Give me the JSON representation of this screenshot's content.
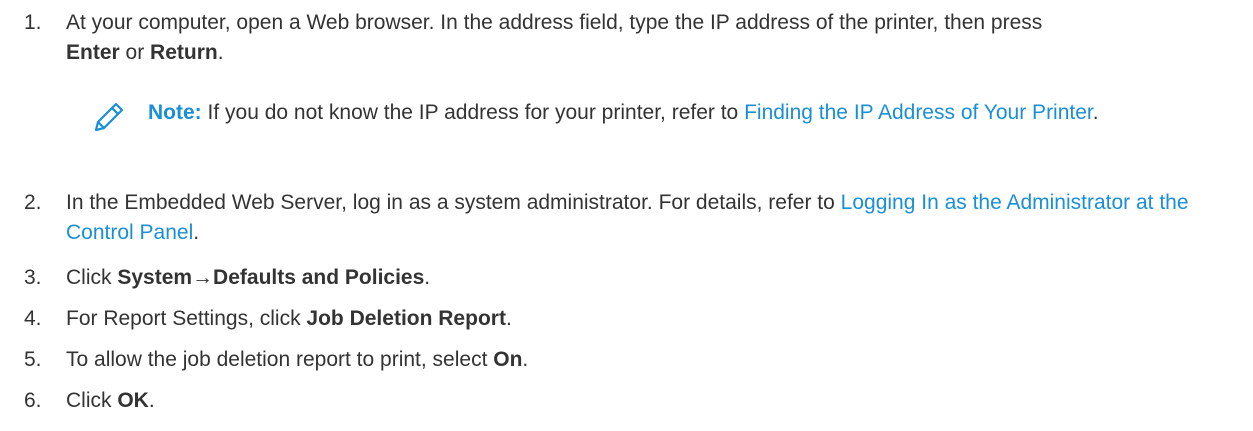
{
  "steps": [
    {
      "number": "1.",
      "parts": [
        "At your computer, open a Web browser. In the address field, type the IP address of the printer, then press ",
        "Enter",
        " or ",
        "Return",
        "."
      ]
    },
    {
      "number": "2.",
      "parts": [
        "In the Embedded Web Server, log in as a system administrator. For details, refer to ",
        "Logging In as the Administrator at the Control Panel",
        "."
      ]
    },
    {
      "number": "3.",
      "parts": [
        "Click ",
        "System→Defaults and Policies",
        "."
      ]
    },
    {
      "number": "4.",
      "parts": [
        "For Report Settings, click ",
        "Job Deletion Report",
        "."
      ]
    },
    {
      "number": "5.",
      "parts": [
        "To allow the job deletion report to print, select ",
        "On",
        "."
      ]
    },
    {
      "number": "6.",
      "parts": [
        "Click ",
        "OK",
        "."
      ]
    }
  ],
  "note": {
    "label": "Note:",
    "text": " If you do not know the IP address for your printer, refer to ",
    "link": "Finding the IP Address of Your Printer",
    "end": ".",
    "icon": "pencil-icon"
  },
  "colors": {
    "link": "#1a8fd6",
    "text": "#333333"
  }
}
